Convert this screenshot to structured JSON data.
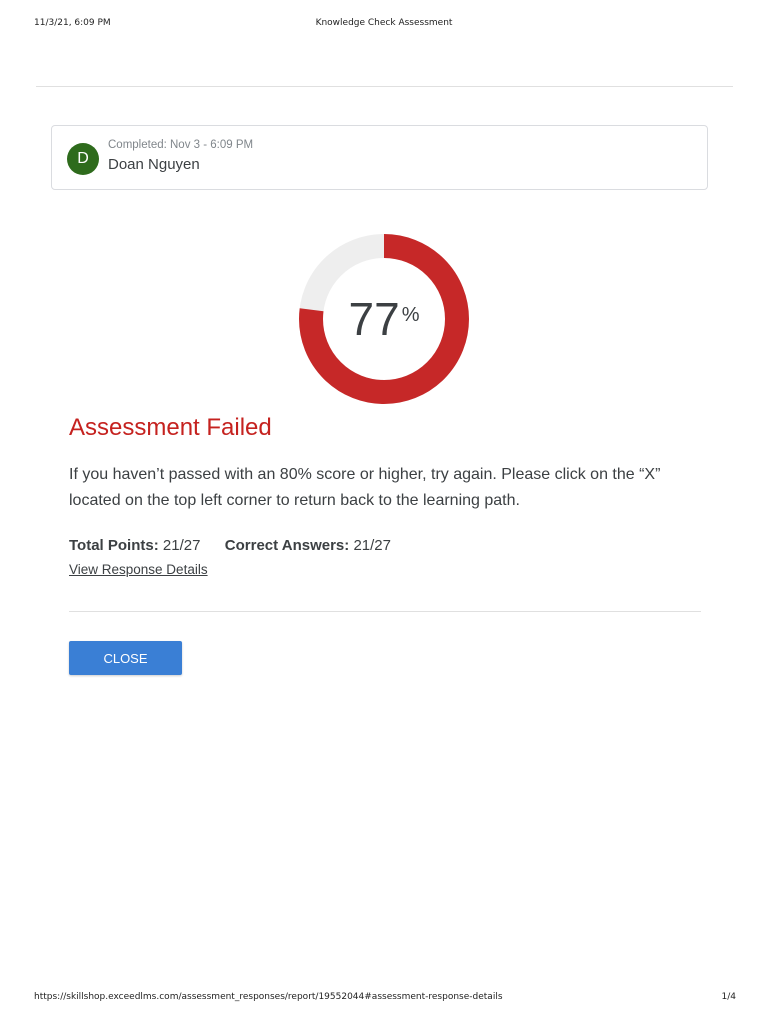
{
  "print_header": {
    "datetime": "11/3/21, 6:09 PM",
    "page_title": "Knowledge Check Assessment"
  },
  "user": {
    "avatar_initial": "D",
    "completed": "Completed: Nov 3 - 6:09 PM",
    "name": "Doan Nguyen"
  },
  "score": {
    "value": "77",
    "unit": "%",
    "fraction": 0.77
  },
  "result": {
    "title": "Assessment Failed",
    "message": "If you haven’t passed with an 80% score or higher, try again. Please click on the “X” located on the top left corner to return back to the learning path.",
    "total_points_label": "Total Points:",
    "total_points_value": "21/27",
    "correct_answers_label": "Correct Answers:",
    "correct_answers_value": "21/27",
    "details_link": "View Response Details"
  },
  "actions": {
    "close_label": "CLOSE"
  },
  "print_footer": {
    "url": "https://skillshop.exceedlms.com/assessment_responses/report/19552044#assessment-response-details",
    "page": "1/4"
  },
  "colors": {
    "score_ring": "#c62828",
    "ring_track": "#eeeeee",
    "failed": "#c5221f",
    "button": "#3a7fd5",
    "avatar": "#2e6b1c"
  }
}
